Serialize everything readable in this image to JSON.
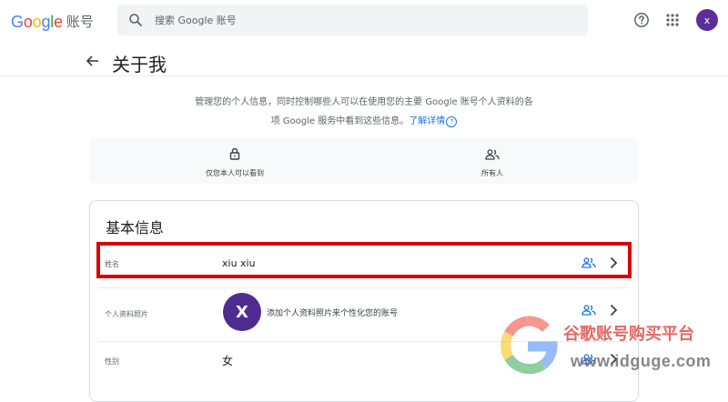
{
  "header": {
    "brand_letters": [
      "G",
      "o",
      "o",
      "g",
      "l",
      "e"
    ],
    "brand_colors": [
      "#4285f4",
      "#ea4335",
      "#fbbc05",
      "#4285f4",
      "#34a853",
      "#ea4335"
    ],
    "product_name": "账号",
    "search": {
      "placeholder": "搜索 Google 账号",
      "icon": "search-icon"
    },
    "help_icon": "help-icon",
    "apps_icon": "apps-icon",
    "avatar_letter": "x",
    "avatar_color": "#5b2e9a"
  },
  "page": {
    "back_icon": "back-arrow-icon",
    "title": "关于我",
    "description_line1": "管理您的个人信息，同时控制哪些人可以在使用您的主要 Google 账号个人资料的各",
    "description_line2": "项 Google 服务中看到这些信息。",
    "learn_more": "了解详情",
    "learn_more_icon": "help-circle-icon"
  },
  "visibility_legend": [
    {
      "icon": "lock-icon",
      "label": "仅您本人可以看到"
    },
    {
      "icon": "people-icon",
      "label": "所有人"
    }
  ],
  "basic_info": {
    "title": "基本信息",
    "rows": {
      "name": {
        "label": "姓名",
        "value": "xiu xiu",
        "visibility_icon": "people-icon",
        "highlighted": true
      },
      "photo": {
        "label": "个人资料照片",
        "avatar_letter": "X",
        "hint": "添加个人资料照片来个性化您的账号",
        "visibility_icon": "people-icon"
      },
      "gender": {
        "label": "性别",
        "value": "女",
        "visibility_icon": "people-icon"
      }
    }
  },
  "colors": {
    "accent_blue": "#1a73e8",
    "highlight_red": "#d90000",
    "avatar_purple": "#4f2c91"
  },
  "watermark": {
    "cn_text": "谷歌账号购买平台",
    "url_text": "www.idguge.com"
  }
}
